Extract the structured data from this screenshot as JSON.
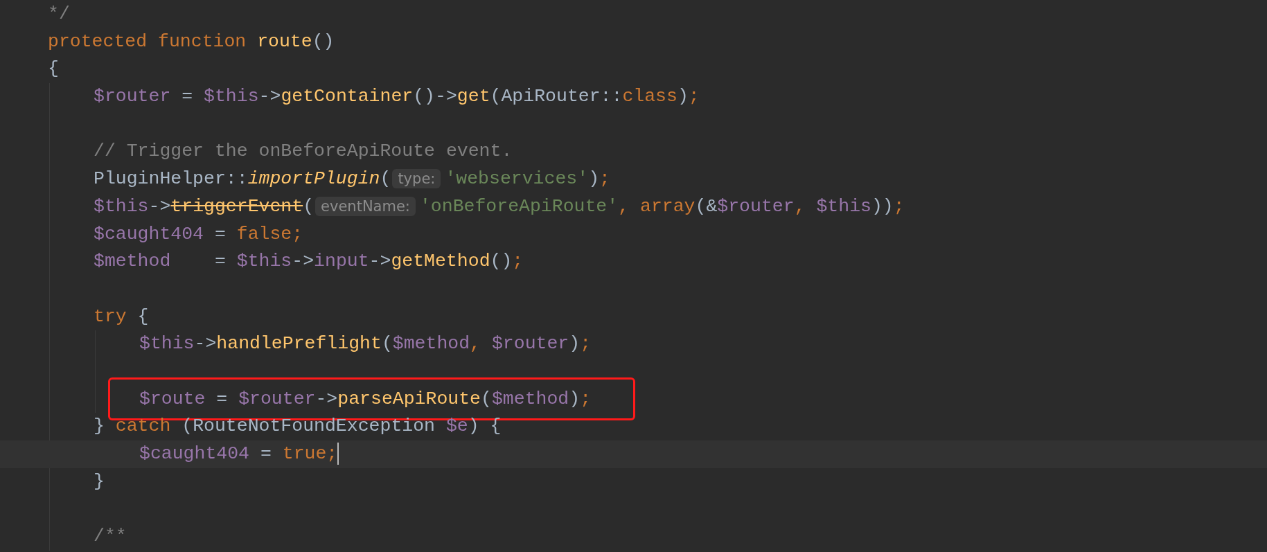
{
  "editor": {
    "lines": [
      {
        "kind": "code",
        "tokens": [
          {
            "t": "*/",
            "kind": "cmt"
          }
        ]
      },
      {
        "kind": "code",
        "tokens": [
          {
            "t": "protected ",
            "kind": "kw"
          },
          {
            "t": "function ",
            "kind": "kw"
          },
          {
            "t": "route",
            "kind": "fn"
          },
          {
            "t": "()",
            "kind": "txt"
          }
        ]
      },
      {
        "kind": "code",
        "tokens": [
          {
            "t": "{",
            "kind": "txt"
          }
        ],
        "children": [
          {
            "kind": "code",
            "tokens": [
              {
                "t": "$router",
                "kind": "var"
              },
              {
                "t": " = ",
                "kind": "txt"
              },
              {
                "t": "$this",
                "kind": "var"
              },
              {
                "t": "->",
                "kind": "txt"
              },
              {
                "t": "getContainer",
                "kind": "fn"
              },
              {
                "t": "()->",
                "kind": "txt"
              },
              {
                "t": "get",
                "kind": "fn"
              },
              {
                "t": "(ApiRouter::",
                "kind": "txt"
              },
              {
                "t": "class",
                "kind": "kw"
              },
              {
                "t": ")",
                "kind": "txt"
              },
              {
                "t": ";",
                "kind": "kw"
              }
            ]
          },
          {
            "kind": "blank"
          },
          {
            "kind": "code",
            "tokens": [
              {
                "t": "// Trigger the onBeforeApiRoute event.",
                "kind": "cmt"
              }
            ]
          },
          {
            "kind": "code",
            "tokens": [
              {
                "t": "PluginHelper::",
                "kind": "txt"
              },
              {
                "t": "importPlugin",
                "kind": "fn-static"
              },
              {
                "t": "(",
                "kind": "txt"
              },
              {
                "t": "type:",
                "kind": "hint"
              },
              {
                "t": "'webservices'",
                "kind": "str"
              },
              {
                "t": ")",
                "kind": "txt"
              },
              {
                "t": ";",
                "kind": "kw"
              }
            ]
          },
          {
            "kind": "code",
            "tokens": [
              {
                "t": "$this",
                "kind": "var"
              },
              {
                "t": "->",
                "kind": "txt"
              },
              {
                "t": "triggerEvent",
                "kind": "fn-deprecated"
              },
              {
                "t": "(",
                "kind": "txt"
              },
              {
                "t": "eventName:",
                "kind": "hint"
              },
              {
                "t": "'onBeforeApiRoute'",
                "kind": "str"
              },
              {
                "t": ", array",
                "kind": "kw"
              },
              {
                "t": "(&",
                "kind": "txt"
              },
              {
                "t": "$router",
                "kind": "var"
              },
              {
                "t": ", ",
                "kind": "kw"
              },
              {
                "t": "$this",
                "kind": "var"
              },
              {
                "t": "))",
                "kind": "txt"
              },
              {
                "t": ";",
                "kind": "kw"
              }
            ]
          },
          {
            "kind": "code",
            "tokens": [
              {
                "t": "$caught404",
                "kind": "var"
              },
              {
                "t": " = ",
                "kind": "txt"
              },
              {
                "t": "false;",
                "kind": "kw"
              }
            ]
          },
          {
            "kind": "code",
            "tokens": [
              {
                "t": "$method",
                "kind": "var"
              },
              {
                "t": "    = ",
                "kind": "txt"
              },
              {
                "t": "$this",
                "kind": "var"
              },
              {
                "t": "->",
                "kind": "txt"
              },
              {
                "t": "input",
                "kind": "var"
              },
              {
                "t": "->",
                "kind": "txt"
              },
              {
                "t": "getMethod",
                "kind": "fn"
              },
              {
                "t": "()",
                "kind": "txt"
              },
              {
                "t": ";",
                "kind": "kw"
              }
            ]
          },
          {
            "kind": "blank"
          },
          {
            "kind": "code",
            "tokens": [
              {
                "t": "try",
                "kind": "kw"
              },
              {
                "t": " {",
                "kind": "txt"
              }
            ],
            "children": [
              {
                "kind": "code",
                "tokens": [
                  {
                    "t": "$this",
                    "kind": "var"
                  },
                  {
                    "t": "->",
                    "kind": "txt"
                  },
                  {
                    "t": "handlePreflight",
                    "kind": "fn"
                  },
                  {
                    "t": "(",
                    "kind": "txt"
                  },
                  {
                    "t": "$method",
                    "kind": "var"
                  },
                  {
                    "t": ", ",
                    "kind": "kw"
                  },
                  {
                    "t": "$router",
                    "kind": "var"
                  },
                  {
                    "t": ")",
                    "kind": "txt"
                  },
                  {
                    "t": ";",
                    "kind": "kw"
                  }
                ]
              },
              {
                "kind": "blank"
              },
              {
                "kind": "code",
                "boxed": true,
                "tokens": [
                  {
                    "t": "$route",
                    "kind": "var"
                  },
                  {
                    "t": " = ",
                    "kind": "txt"
                  },
                  {
                    "t": "$router",
                    "kind": "var"
                  },
                  {
                    "t": "->",
                    "kind": "txt"
                  },
                  {
                    "t": "parseApiRoute",
                    "kind": "fn"
                  },
                  {
                    "t": "(",
                    "kind": "txt"
                  },
                  {
                    "t": "$method",
                    "kind": "var"
                  },
                  {
                    "t": ")",
                    "kind": "txt"
                  },
                  {
                    "t": ";",
                    "kind": "kw"
                  }
                ]
              }
            ]
          },
          {
            "kind": "code",
            "tokens": [
              {
                "t": "} ",
                "kind": "txt"
              },
              {
                "t": "catch",
                "kind": "kw"
              },
              {
                "t": " (RouteNotFoundException ",
                "kind": "txt"
              },
              {
                "t": "$e",
                "kind": "var"
              },
              {
                "t": ") {",
                "kind": "txt"
              }
            ],
            "children": [
              {
                "kind": "code",
                "current": true,
                "tokens": [
                  {
                    "t": "$caught404",
                    "kind": "var"
                  },
                  {
                    "t": " = ",
                    "kind": "txt"
                  },
                  {
                    "t": "true;",
                    "kind": "kw"
                  }
                ]
              }
            ]
          },
          {
            "kind": "code",
            "tokens": [
              {
                "t": "}",
                "kind": "txt"
              }
            ]
          },
          {
            "kind": "blank"
          },
          {
            "kind": "code",
            "tokens": [
              {
                "t": "/**",
                "kind": "cmt"
              }
            ]
          }
        ]
      }
    ]
  }
}
